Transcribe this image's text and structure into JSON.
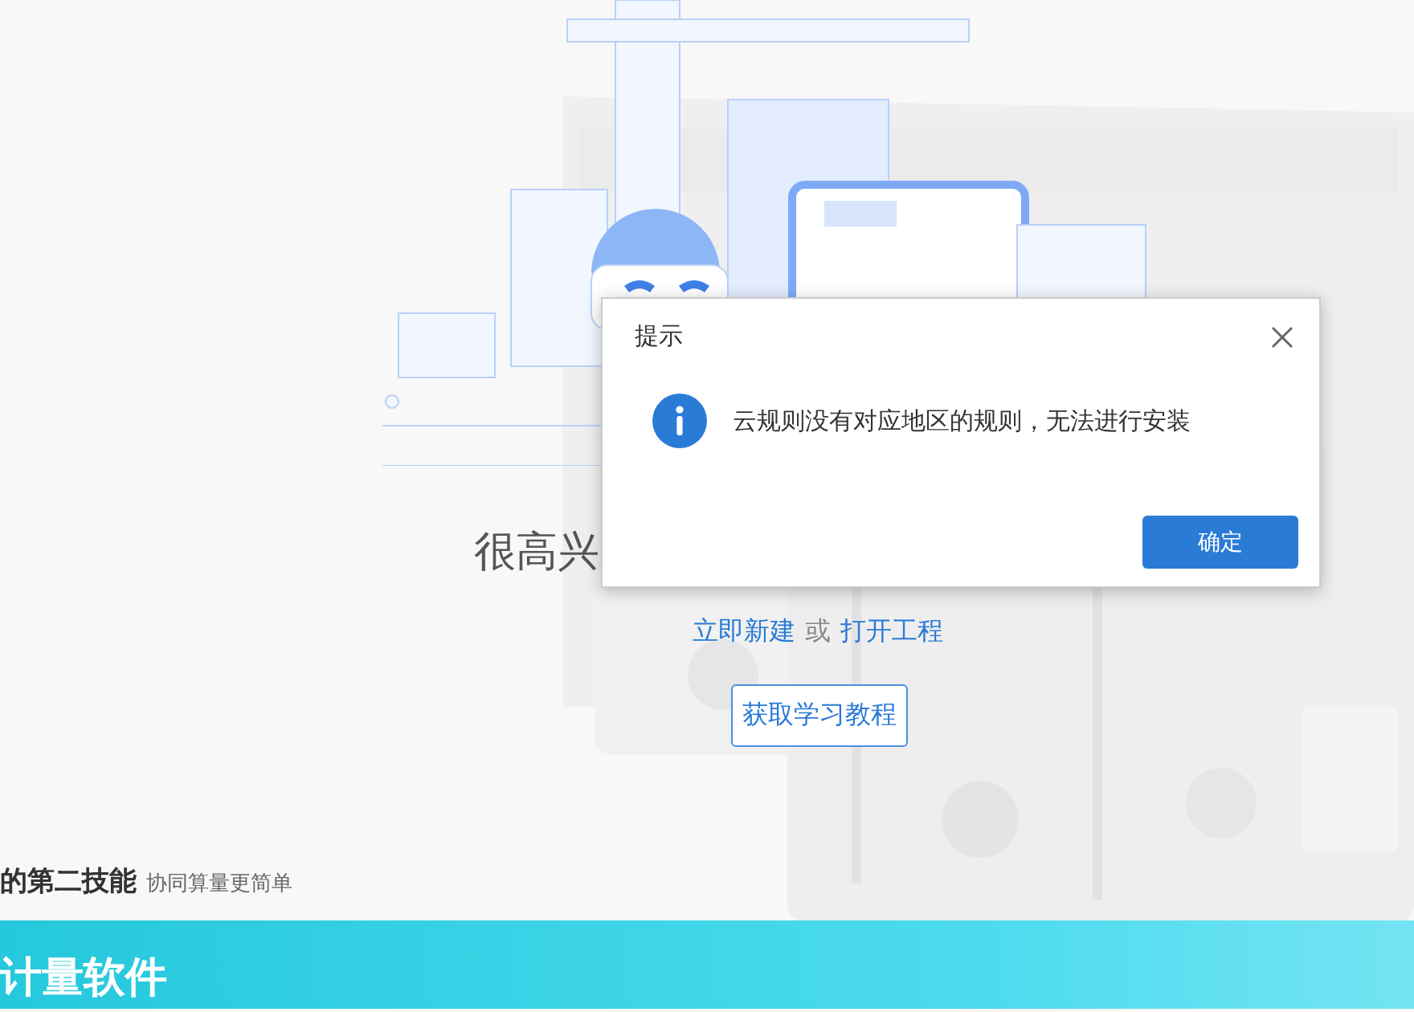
{
  "welcome": {
    "text": "很高兴"
  },
  "actions": {
    "new_link": "立即新建",
    "separator": "或",
    "open_link": "打开工程"
  },
  "tutorial_button": "获取学习教程",
  "feature": {
    "title": "的第二技能",
    "subtitle": "协同算量更简单"
  },
  "banner": {
    "title": "计量软件"
  },
  "dialog": {
    "title": "提示",
    "message": "云规则没有对应地区的规则，无法进行安装",
    "buttons": [
      "确定"
    ]
  }
}
